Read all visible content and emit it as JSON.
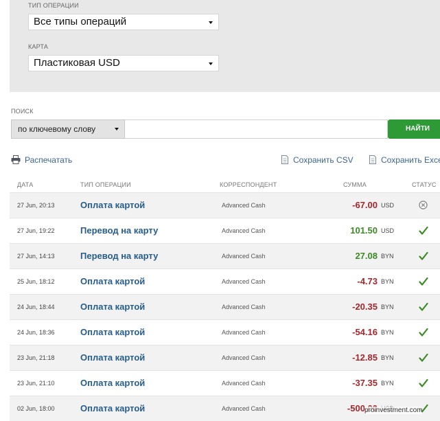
{
  "filters": {
    "operation_type_label": "ТИП ОПЕРАЦИИ",
    "operation_type_value": "Все типы операций",
    "card_label": "КАРТА",
    "card_value": "Пластиковая USD"
  },
  "search": {
    "label": "ПОИСК",
    "mode_value": "по ключевому слову",
    "query": "",
    "button": "НАЙТИ"
  },
  "actions": {
    "print": "Распечатать",
    "save_csv": "Сохранить CSV",
    "save_excel": "Сохранить Exce"
  },
  "table": {
    "headers": {
      "date": "ДАТА",
      "type": "ТИП ОПЕРАЦИИ",
      "correspondent": "КОРРЕСПОНДЕНТ",
      "amount": "СУММА",
      "status": "СТАТУС"
    },
    "rows": [
      {
        "date": "27 Jun, 20:13",
        "type": "Оплата картой",
        "correspondent": "Advanced Cash",
        "amount": "-67.00",
        "currency": "USD",
        "sign": "neg",
        "status": "cancelled-icon"
      },
      {
        "date": "27 Jun, 19:22",
        "type": "Перевод на карту",
        "correspondent": "Advanced Cash",
        "amount": "101.50",
        "currency": "USD",
        "sign": "pos",
        "status": "check-icon"
      },
      {
        "date": "27 Jun, 14:13",
        "type": "Перевод на карту",
        "correspondent": "Advanced Cash",
        "amount": "27.08",
        "currency": "BYN",
        "sign": "pos",
        "status": "check-icon"
      },
      {
        "date": "25 Jun, 18:12",
        "type": "Оплата картой",
        "correspondent": "Advanced Cash",
        "amount": "-4.73",
        "currency": "BYN",
        "sign": "neg",
        "status": "check-icon"
      },
      {
        "date": "24 Jun, 18:44",
        "type": "Оплата картой",
        "correspondent": "Advanced Cash",
        "amount": "-20.35",
        "currency": "BYN",
        "sign": "neg",
        "status": "check-icon"
      },
      {
        "date": "24 Jun, 18:36",
        "type": "Оплата картой",
        "correspondent": "Advanced Cash",
        "amount": "-54.16",
        "currency": "BYN",
        "sign": "neg",
        "status": "check-icon"
      },
      {
        "date": "23 Jun, 21:18",
        "type": "Оплата картой",
        "correspondent": "Advanced Cash",
        "amount": "-12.85",
        "currency": "BYN",
        "sign": "neg",
        "status": "check-icon"
      },
      {
        "date": "23 Jun, 21:10",
        "type": "Оплата картой",
        "correspondent": "Advanced Cash",
        "amount": "-37.35",
        "currency": "BYN",
        "sign": "neg",
        "status": "check-icon"
      },
      {
        "date": "02 Jun, 18:00",
        "type": "Оплата картой",
        "correspondent": "Advanced Cash",
        "amount": "-500.00",
        "currency": "USD",
        "sign": "neg",
        "status": "check-icon"
      }
    ]
  },
  "watermark": "proinvestment.com",
  "colors": {
    "accent_green": "#2d9a36",
    "link_blue": "#265d8a",
    "negative": "#a4272b",
    "positive": "#3c8a24"
  }
}
